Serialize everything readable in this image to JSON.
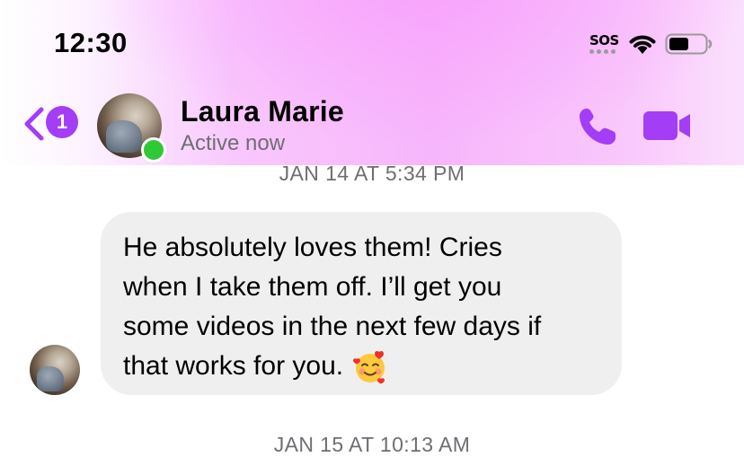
{
  "status_bar": {
    "time": "12:30",
    "sos": "SOS"
  },
  "header": {
    "unread_count": "1",
    "contact_name": "Laura Marie",
    "contact_status": "Active now"
  },
  "messages": [
    {
      "timestamp": "JAN 14 AT 5:34 PM",
      "sender": "Laura Marie",
      "text": "He absolutely loves them! Cries\nwhen I take them off. I’ll get you\nsome videos in the next few days if\nthat works for you.",
      "emoji": "smiling-face-with-hearts"
    },
    {
      "timestamp": "JAN 15 AT 10:13 AM"
    }
  ],
  "colors": {
    "accent": "#a33df6",
    "online": "#2dc937",
    "bubble": "#efeff0",
    "secondary_text": "#6e6e73"
  }
}
